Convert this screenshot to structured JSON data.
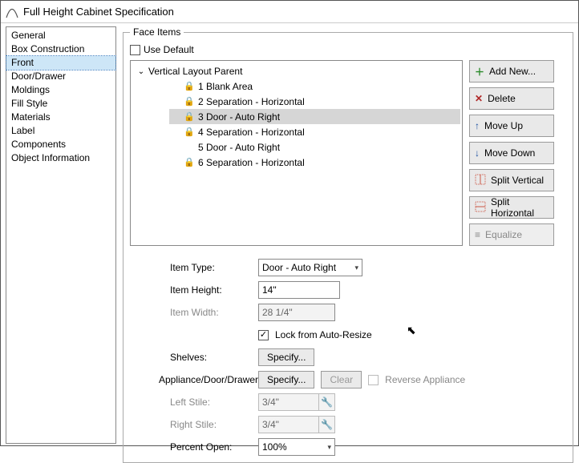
{
  "window": {
    "title": "Full Height Cabinet Specification"
  },
  "sidebar": {
    "items": [
      {
        "label": "General"
      },
      {
        "label": "Box Construction"
      },
      {
        "label": "Front"
      },
      {
        "label": "Door/Drawer"
      },
      {
        "label": "Moldings"
      },
      {
        "label": "Fill Style"
      },
      {
        "label": "Materials"
      },
      {
        "label": "Label"
      },
      {
        "label": "Components"
      },
      {
        "label": "Object Information"
      }
    ],
    "selected_index": 2
  },
  "face_items": {
    "legend": "Face Items",
    "use_default_label": "Use Default",
    "use_default_checked": false,
    "tree": {
      "parent": "Vertical Layout Parent",
      "items": [
        {
          "locked": true,
          "label": "1 Blank Area"
        },
        {
          "locked": true,
          "label": "2 Separation - Horizontal"
        },
        {
          "locked": true,
          "label": "3 Door - Auto Right"
        },
        {
          "locked": true,
          "label": "4 Separation - Horizontal"
        },
        {
          "locked": false,
          "label": "5 Door - Auto Right"
        },
        {
          "locked": true,
          "label": "6 Separation - Horizontal"
        }
      ],
      "selected_index": 2
    },
    "buttons": {
      "add_new": "Add New...",
      "delete": "Delete",
      "move_up": "Move Up",
      "move_down": "Move Down",
      "split_vertical": "Split Vertical",
      "split_horizontal": "Split Horizontal",
      "equalize": "Equalize"
    }
  },
  "form": {
    "item_type": {
      "label": "Item Type:",
      "value": "Door - Auto Right"
    },
    "item_height": {
      "label": "Item Height:",
      "value": "14\""
    },
    "item_width": {
      "label": "Item Width:",
      "value": "28 1/4\""
    },
    "lock_auto_resize": {
      "label": "Lock from Auto-Resize",
      "checked": true
    },
    "shelves": {
      "label": "Shelves:",
      "button": "Specify..."
    },
    "appliance": {
      "label": "Appliance/Door/Drawer:",
      "specify": "Specify...",
      "clear": "Clear",
      "reverse": "Reverse Appliance",
      "reverse_checked": false
    },
    "left_stile": {
      "label": "Left Stile:",
      "value": "3/4\""
    },
    "right_stile": {
      "label": "Right Stile:",
      "value": "3/4\""
    },
    "percent_open": {
      "label": "Percent Open:",
      "value": "100%"
    }
  },
  "icons": {
    "lock": "🔒",
    "expand": "⌄",
    "plus": "＋",
    "x": "✕",
    "up": "↑",
    "down": "↓",
    "eq": "≡",
    "wrench": "🔧",
    "chev": "▾",
    "check": "✓",
    "cursor": "↖"
  },
  "colors": {
    "add": "#2a8a2a",
    "delete": "#b02727",
    "arrow": "#1a4fa0"
  }
}
